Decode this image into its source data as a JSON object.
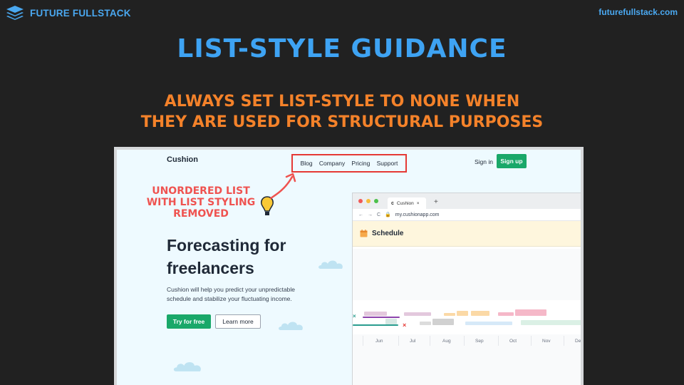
{
  "brand": {
    "name": "FUTURE FULLSTACK",
    "url": "futurefullstack.com"
  },
  "slide": {
    "title": "LIST-STYLE GUIDANCE",
    "subtitle_lines": [
      "ALWAYS SET LIST-STYLE TO NONE WHEN",
      "THEY ARE USED FOR STRUCTURAL PURPOSES"
    ],
    "annotation_lines": [
      "UNORDERED LIST",
      "WITH LIST STYLING",
      "REMOVED"
    ]
  },
  "site": {
    "logo": "Cushion",
    "nav": [
      "Blog",
      "Company",
      "Pricing",
      "Support"
    ],
    "sign_in": "Sign in",
    "sign_up": "Sign up",
    "hero_title_lines": [
      "Forecasting for",
      "freelancers"
    ],
    "hero_text": "Cushion will help you predict your unpredictable schedule and stabilize your fluctuating income.",
    "try_button": "Try for free",
    "learn_button": "Learn more"
  },
  "browser": {
    "tab_icon": "c",
    "tab_label": "Cushion",
    "tab_close": "×",
    "new_tab": "+",
    "url": "my.cushionapp.com",
    "header": "Schedule",
    "months": [
      "Jun",
      "Jul",
      "Aug",
      "Sep",
      "Oct",
      "Nov",
      "De"
    ]
  },
  "colors": {
    "background": "#212121",
    "brand_blue": "#4aa8f0",
    "title_blue": "#3ea3f3",
    "subtitle_orange": "#f4822a",
    "annotation_red": "#ef5350",
    "cushion_green": "#1aa869"
  },
  "icons": {
    "brand": "layers-icon",
    "annotation": "lightbulb-icon",
    "pointer": "curved-arrow-icon",
    "calendar": "calendar-icon"
  }
}
